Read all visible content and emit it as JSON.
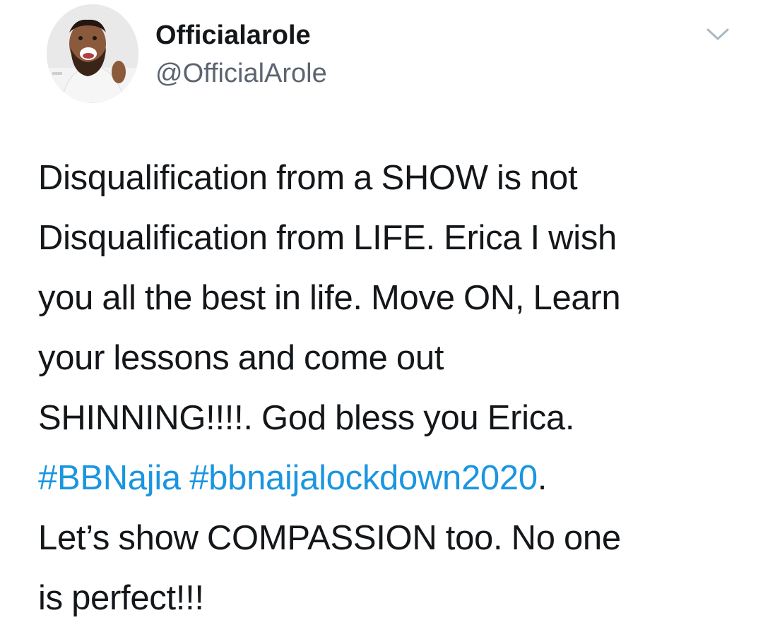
{
  "user": {
    "display_name": "Officialarole",
    "handle": "@OfficialArole",
    "avatar_icon": "avatar-photo"
  },
  "menu": {
    "icon": "chevron-down-icon",
    "color": "#aab8c2"
  },
  "tweet": {
    "lines": [
      {
        "text": "Disqualification from a SHOW is not"
      },
      {
        "text": "Disqualification from LIFE. Erica I wish"
      },
      {
        "text": "you all the best in life. Move ON, Learn"
      },
      {
        "text": "your lessons and come out"
      },
      {
        "text": "SHINNING!!!!. God bless you Erica."
      },
      {
        "hashtag1": "#BBNajia",
        "sep": " ",
        "hashtag2": "#bbnaijalockdown2020",
        "trail": "."
      },
      {
        "text": "Let’s show COMPASSION too. No one"
      },
      {
        "text": "is perfect!!!"
      }
    ]
  },
  "colors": {
    "text": "#14171a",
    "secondary": "#5b6570",
    "link": "#1b95e0"
  }
}
